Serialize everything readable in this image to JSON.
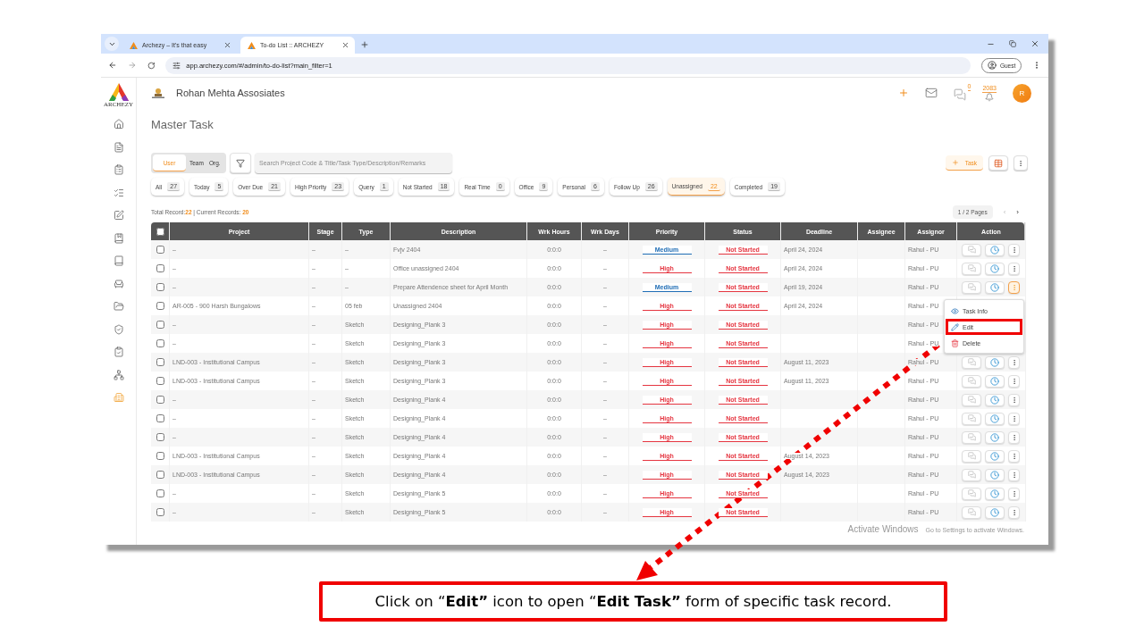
{
  "browser": {
    "tabs": [
      {
        "title": "Archezy – It's that easy",
        "selected": false
      },
      {
        "title": "To-do List :: ARCHEZY",
        "selected": true
      }
    ],
    "url": "app.archezy.com/#/admin/to-do-list?main_filter=1",
    "profile": "Guest"
  },
  "sidebar": {
    "brand": "ARCHEZY",
    "items": [
      {
        "selected": false
      },
      {
        "selected": false
      },
      {
        "selected": false
      },
      {
        "selected": false
      },
      {
        "selected": false
      },
      {
        "selected": false
      },
      {
        "selected": false
      },
      {
        "selected": false
      },
      {
        "selected": false
      },
      {
        "selected": false
      },
      {
        "selected": false
      },
      {
        "selected": false
      },
      {
        "selected": true
      }
    ]
  },
  "header": {
    "company": "Rohan Mehta Assosiates",
    "chat_count": "0",
    "notification_count": "2083",
    "avatar": "R"
  },
  "page_title": "Master Task",
  "scope_tabs": [
    {
      "label": "User",
      "selected": true
    },
    {
      "label": "Team",
      "selected": false
    },
    {
      "label": "Org.",
      "selected": false
    }
  ],
  "search": {
    "placeholder": "Search Project Code & Title/Task Type/Description/Remarks"
  },
  "add_task_button": "Task",
  "filters": [
    {
      "label": "All",
      "count": "27",
      "selected": false
    },
    {
      "label": "Today",
      "count": "5",
      "selected": false
    },
    {
      "label": "Over Due",
      "count": "21",
      "selected": false
    },
    {
      "label": "High Priority",
      "count": "23",
      "selected": false
    },
    {
      "label": "Query",
      "count": "1",
      "selected": false
    },
    {
      "label": "Not Started",
      "count": "18",
      "selected": false
    },
    {
      "label": "Real Time",
      "count": "0",
      "selected": false
    },
    {
      "label": "Office",
      "count": "9",
      "selected": false
    },
    {
      "label": "Personal",
      "count": "6",
      "selected": false
    },
    {
      "label": "Follow Up",
      "count": "26",
      "selected": false
    },
    {
      "label": "Unassigned",
      "count": "22",
      "selected": true
    },
    {
      "label": "Completed",
      "count": "19",
      "selected": false
    }
  ],
  "records": {
    "total_label": "Total Record:",
    "total": "22",
    "current_label": "| Current Records:",
    "current": "20"
  },
  "pagination": {
    "pages": "1 / 2 Pages",
    "prev": "‹",
    "next": "›",
    "prev_disabled": true
  },
  "table": {
    "select_all_checked": false,
    "columns": [
      "Project",
      "Stage",
      "Type",
      "Description",
      "Wrk Hours",
      "Wrk Days",
      "Priority",
      "Status",
      "Deadline",
      "Assignee",
      "Assignor",
      "Action"
    ],
    "rows": [
      {
        "checked": false,
        "project": "–",
        "stage": "–",
        "type": "–",
        "description": "Fvjv 2404",
        "wrk_hours": "0:0:0",
        "wrk_days": "–",
        "priority": {
          "label": "Medium",
          "kind": "medium"
        },
        "status": "Not Started",
        "deadline": "April 24, 2024",
        "assignor": "Rahul - PU",
        "menu_open": false
      },
      {
        "checked": false,
        "project": "–",
        "stage": "–",
        "type": "–",
        "description": "Office unassigned 2404",
        "wrk_hours": "0:0:0",
        "wrk_days": "–",
        "priority": {
          "label": "High",
          "kind": "high"
        },
        "status": "Not Started",
        "deadline": "April 24, 2024",
        "assignor": "Rahul - PU",
        "menu_open": false
      },
      {
        "checked": false,
        "project": "–",
        "stage": "–",
        "type": "–",
        "description": "Prepare Attendence sheet for April Month",
        "wrk_hours": "0:0:0",
        "wrk_days": "–",
        "priority": {
          "label": "Medium",
          "kind": "medium"
        },
        "status": "Not Started",
        "deadline": "April 19, 2024",
        "assignor": "Rahul - PU",
        "menu_open": true
      },
      {
        "checked": false,
        "project": "AR-005 - 900 Harsh Bungalows",
        "stage": "–",
        "type": "05 feb",
        "description": "Unassigned 2404",
        "wrk_hours": "0:0:0",
        "wrk_days": "–",
        "priority": {
          "label": "High",
          "kind": "high"
        },
        "status": "Not Started",
        "deadline": "April 24, 2024",
        "assignor": "Rahul - PU"
      },
      {
        "checked": false,
        "project": "–",
        "stage": "–",
        "type": "Sketch",
        "description": "Designing_Plank 3",
        "wrk_hours": "0:0:0",
        "wrk_days": "–",
        "priority": {
          "label": "High",
          "kind": "high"
        },
        "status": "Not Started",
        "assignor": "Rahul - PU"
      },
      {
        "checked": false,
        "project": "–",
        "stage": "–",
        "type": "Sketch",
        "description": "Designing_Plank 3",
        "wrk_hours": "0:0:0",
        "wrk_days": "–",
        "priority": {
          "label": "High",
          "kind": "high"
        },
        "status": "Not Started",
        "assignor": "Rahul - PU"
      },
      {
        "checked": false,
        "project": "LND-003 - Institutional Campus",
        "stage": "–",
        "type": "Sketch",
        "description": "Designing_Plank 3",
        "wrk_hours": "0:0:0",
        "wrk_days": "–",
        "priority": {
          "label": "High",
          "kind": "high"
        },
        "status": "Not Started",
        "deadline": "August 11, 2023",
        "assignor": "Rahul - PU",
        "menu_open": false
      },
      {
        "checked": false,
        "project": "LND-003 - Institutional Campus",
        "stage": "–",
        "type": "Sketch",
        "description": "Designing_Plank 3",
        "wrk_hours": "0:0:0",
        "wrk_days": "–",
        "priority": {
          "label": "High",
          "kind": "high"
        },
        "status": "Not Started",
        "deadline": "August 11, 2023",
        "assignor": "Rahul - PU",
        "menu_open": false
      },
      {
        "checked": false,
        "project": "–",
        "stage": "–",
        "type": "Sketch",
        "description": "Designing_Plank 4",
        "wrk_hours": "0:0:0",
        "wrk_days": "–",
        "priority": {
          "label": "High",
          "kind": "high"
        },
        "status": "Not Started",
        "assignor": "Rahul - PU",
        "menu_open": false
      },
      {
        "checked": false,
        "project": "–",
        "stage": "–",
        "type": "Sketch",
        "description": "Designing_Plank 4",
        "wrk_hours": "0:0:0",
        "wrk_days": "–",
        "priority": {
          "label": "High",
          "kind": "high"
        },
        "status": "Not Started",
        "assignor": "Rahul - PU",
        "menu_open": false
      },
      {
        "checked": false,
        "project": "–",
        "stage": "–",
        "type": "Sketch",
        "description": "Designing_Plank 4",
        "wrk_hours": "0:0:0",
        "wrk_days": "–",
        "priority": {
          "label": "High",
          "kind": "high"
        },
        "status": "Not Started",
        "assignor": "Rahul - PU",
        "menu_open": false
      },
      {
        "checked": false,
        "project": "LND-003 - Institutional Campus",
        "stage": "–",
        "type": "Sketch",
        "description": "Designing_Plank 4",
        "wrk_hours": "0:0:0",
        "wrk_days": "–",
        "priority": {
          "label": "High",
          "kind": "high"
        },
        "status": "Not Started",
        "deadline": "August 14, 2023",
        "assignor": "Rahul - PU",
        "menu_open": false
      },
      {
        "checked": false,
        "project": "LND-003 - Institutional Campus",
        "stage": "–",
        "type": "Sketch",
        "description": "Designing_Plank 4",
        "wrk_hours": "0:0:0",
        "wrk_days": "–",
        "priority": {
          "label": "High",
          "kind": "high"
        },
        "status": "Not Started",
        "deadline": "August 14, 2023",
        "assignor": "Rahul - PU",
        "menu_open": false
      },
      {
        "checked": false,
        "project": "–",
        "stage": "–",
        "type": "Sketch",
        "description": "Designing_Plank 5",
        "wrk_hours": "0:0:0",
        "wrk_days": "–",
        "priority": {
          "label": "High",
          "kind": "high"
        },
        "status": "Not Started",
        "assignor": "Rahul - PU",
        "menu_open": false
      },
      {
        "checked": false,
        "project": "–",
        "stage": "–",
        "type": "Sketch",
        "description": "Designing_Plank 5",
        "wrk_hours": "0:0:0",
        "wrk_days": "–",
        "priority": {
          "label": "High",
          "kind": "high"
        },
        "status": "Not Started",
        "assignor": "Rahul - PU",
        "menu_open": false
      }
    ]
  },
  "row_menu": {
    "items": [
      {
        "label": "Task Info",
        "kind": "info",
        "highlighted": false
      },
      {
        "label": "Edit",
        "kind": "edit",
        "highlighted": true
      },
      {
        "label": "Delete",
        "kind": "delete",
        "highlighted": false
      }
    ]
  },
  "os_watermark": {
    "title": "Activate Windows",
    "subtitle": "Go to Settings to activate Windows."
  },
  "annotation": {
    "text": "Click on “**Edit”** icon to open “**Edit Task”** form of specific task record."
  }
}
